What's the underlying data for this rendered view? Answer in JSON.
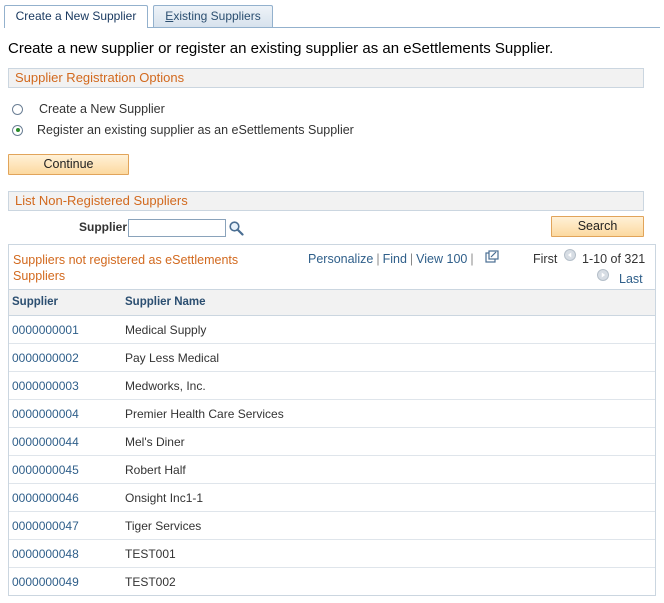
{
  "tabs": [
    {
      "label": "Create a New Supplier"
    },
    {
      "label_first": "E",
      "label_rest": "xisting Suppliers"
    }
  ],
  "instructions": "Create a new supplier or register an existing supplier as an eSettlements Supplier.",
  "registration": {
    "header": "Supplier Registration Options",
    "options": [
      {
        "label": "Create a New Supplier",
        "checked": false
      },
      {
        "label": "Register an existing supplier as an eSettlements Supplier",
        "checked": true
      }
    ],
    "continue_label": "Continue"
  },
  "list": {
    "header": "List Non-Registered Suppliers",
    "supplier_label": "Supplier",
    "supplier_value": "",
    "search_label": "Search"
  },
  "grid": {
    "title": "Suppliers not registered as eSettlements Suppliers",
    "personalize": "Personalize",
    "find": "Find",
    "view": "View 100",
    "first": "First",
    "range": "1-10 of 321",
    "last": "Last",
    "columns": [
      "Supplier",
      "Supplier Name"
    ],
    "rows": [
      {
        "id": "0000000001",
        "name": "Medical Supply"
      },
      {
        "id": "0000000002",
        "name": "Pay Less Medical"
      },
      {
        "id": "0000000003",
        "name": "Medworks, Inc."
      },
      {
        "id": "0000000004",
        "name": "Premier Health Care Services"
      },
      {
        "id": "0000000044",
        "name": "Mel's Diner"
      },
      {
        "id": "0000000045",
        "name": "Robert Half"
      },
      {
        "id": "0000000046",
        "name": "Onsight Inc1-1"
      },
      {
        "id": "0000000047",
        "name": "Tiger Services"
      },
      {
        "id": "0000000048",
        "name": "TEST001"
      },
      {
        "id": "0000000049",
        "name": "TEST002"
      }
    ]
  },
  "icons": {
    "lookup": "magnifier-icon",
    "popout": "new-window-icon",
    "prev": "previous-arrow-icon",
    "next": "next-arrow-icon"
  },
  "colors": {
    "accent": "#d2691e",
    "link": "#2f5f8a",
    "button": "#fcd9a0"
  }
}
